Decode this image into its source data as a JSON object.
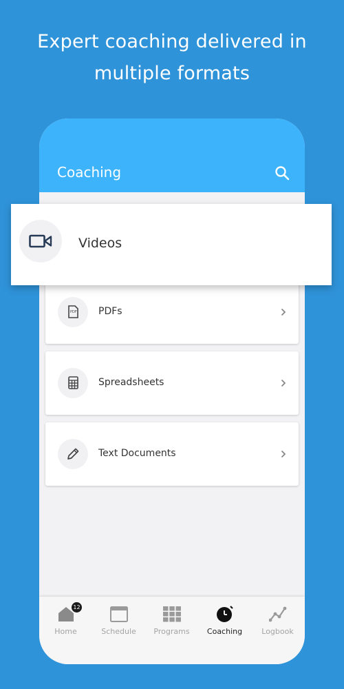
{
  "headline": {
    "line1": "Expert coaching delivered in",
    "line2": "multiple formats"
  },
  "appbar": {
    "title": "Coaching",
    "search_icon": "search-icon"
  },
  "featured": {
    "label": "Videos",
    "icon": "video-camera-icon"
  },
  "items": [
    {
      "label": "PDFs",
      "icon": "pdf-file-icon"
    },
    {
      "label": "Spreadsheets",
      "icon": "spreadsheet-icon"
    },
    {
      "label": "Text Documents",
      "icon": "pencil-icon"
    }
  ],
  "tabs": [
    {
      "label": "Home",
      "icon": "home-icon",
      "badge": "12",
      "active": false
    },
    {
      "label": "Schedule",
      "icon": "calendar-icon",
      "active": false
    },
    {
      "label": "Programs",
      "icon": "grid-icon",
      "active": false
    },
    {
      "label": "Coaching",
      "icon": "stopwatch-icon",
      "active": true
    },
    {
      "label": "Logbook",
      "icon": "chart-line-icon",
      "active": false
    }
  ],
  "colors": {
    "background": "#2f93d9",
    "appbar": "#3db3fb",
    "active_tab": "#222222",
    "inactive_tab": "#a3a3a3"
  }
}
